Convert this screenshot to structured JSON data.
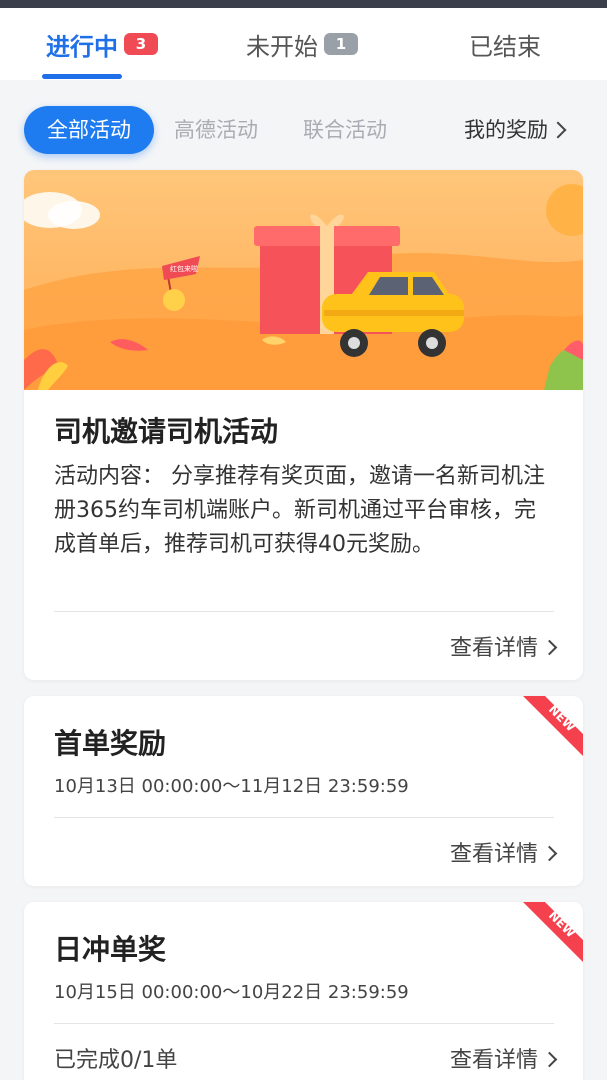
{
  "status_tabs": [
    {
      "label": "进行中",
      "count": "3"
    },
    {
      "label": "未开始",
      "count": "1"
    },
    {
      "label": "已结束"
    }
  ],
  "filters": {
    "chips": [
      "全部活动",
      "高德活动",
      "联合活动"
    ],
    "my_reward": "我的奖励"
  },
  "banner": {
    "flag_text": "红包来啦",
    "icon": "gift-box-car-illustration"
  },
  "cards": [
    {
      "title": "司机邀请司机活动",
      "description": "活动内容： 分享推荐有奖页面，邀请一名新司机注册365约车司机端账户。新司机通过平台审核，完成首单后，推荐司机可获得40元奖励。",
      "detail_label": "查看详情"
    },
    {
      "title": "首单奖励",
      "date_range": "10月13日 00:00:00～11月12日 23:59:59",
      "ribbon": "NEW",
      "detail_label": "查看详情"
    },
    {
      "title": "日冲单奖",
      "date_range": "10月15日 00:00:00～10月22日 23:59:59",
      "ribbon": "NEW",
      "progress": "已完成0/1单",
      "detail_label": "查看详情"
    }
  ],
  "colors": {
    "accent": "#1f6fe8",
    "chip_active": "#1f7cf0",
    "badge_red": "#f04a55",
    "badge_gray": "#9aa0a8",
    "ribbon_red": "#f5414d",
    "banner_orange": "#ffb35c"
  }
}
